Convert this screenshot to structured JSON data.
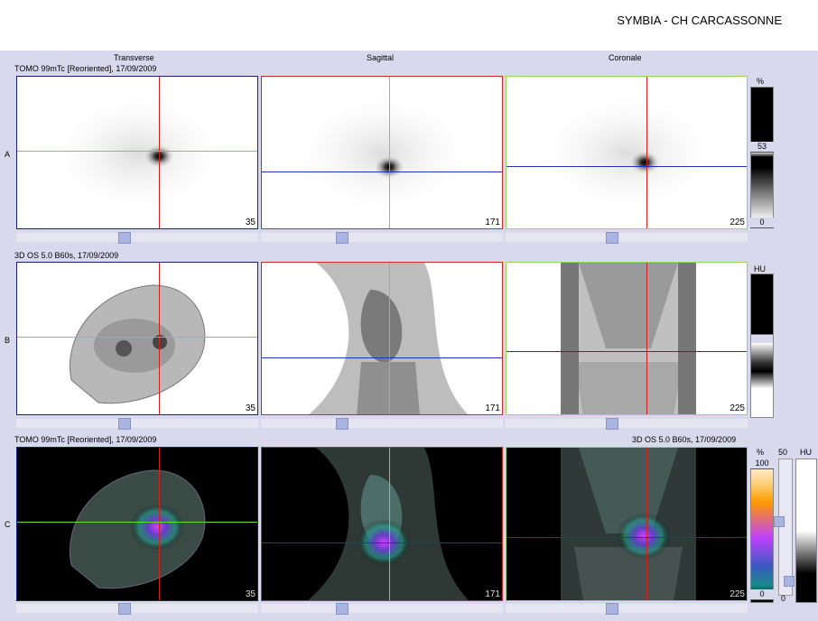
{
  "header": {
    "title": "SYMBIA - CH CARCASSONNE"
  },
  "views": {
    "transverse": "Transverse",
    "sagittal": "Sagittal",
    "coronal": "Coronale"
  },
  "rows": [
    {
      "label": "A",
      "series": "TOMO 99mTc [Reoriented], 17/09/2009",
      "series_right": "",
      "modality": "spect",
      "numbers": [
        "35",
        "171",
        "225"
      ]
    },
    {
      "label": "B",
      "series": "3D  OS  5.0  B60s, 17/09/2009",
      "series_right": "",
      "modality": "ct",
      "numbers": [
        "35",
        "171",
        "225"
      ]
    },
    {
      "label": "C",
      "series": "TOMO 99mTc [Reoriented], 17/09/2009",
      "series_right": "3D  OS  5.0  B60s, 17/09/2009",
      "modality": "fusion",
      "numbers": [
        "35",
        "171",
        "225"
      ]
    }
  ],
  "scales": {
    "spect": {
      "unit": "%",
      "level": "53",
      "min": "0"
    },
    "ct": {
      "unit": "HU"
    },
    "fusion": {
      "unit": "%",
      "max": "100",
      "min": "0",
      "ct_unit": "HU",
      "ct_level": "50",
      "ct_min": "0"
    }
  },
  "colors": {
    "background": "#d9d9ee",
    "transverse_border": "#1a2080",
    "sagittal_border": "#cc2a2a",
    "coronal_border": "#9ad85a",
    "crosshair_red": "#d02020",
    "crosshair_green": "#66e030",
    "crosshair_blue": "#2030c0"
  }
}
